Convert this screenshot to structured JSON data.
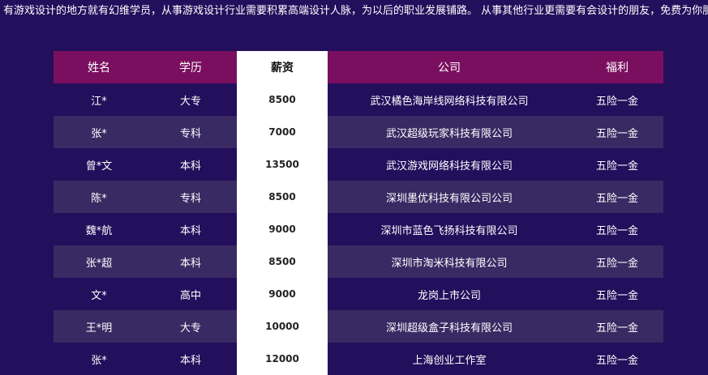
{
  "intro_text": "有游戏设计的地方就有幻维学员，从事游戏设计行业需要积累高端设计人脉，为以后的职业发展铺路。 从事其他行业更需要有会设计的朋友，免费为你服务。",
  "table": {
    "headers": {
      "name": "姓名",
      "education": "学历",
      "salary": "薪资",
      "company": "公司",
      "benefits": "福利"
    },
    "rows": [
      {
        "name": "江*",
        "education": "大专",
        "salary": "8500",
        "company": "武汉橘色海岸线网络科技有限公司",
        "benefits": "五险一金"
      },
      {
        "name": "张*",
        "education": "专科",
        "salary": "7000",
        "company": "武汉超级玩家科技有限公司",
        "benefits": "五险一金"
      },
      {
        "name": "曾*文",
        "education": "本科",
        "salary": "13500",
        "company": "武汉游戏网络科技有限公司",
        "benefits": "五险一金"
      },
      {
        "name": "陈*",
        "education": "专科",
        "salary": "8500",
        "company": "深圳墨优科技有限公司公司",
        "benefits": "五险一金"
      },
      {
        "name": "魏*航",
        "education": "本科",
        "salary": "9000",
        "company": "深圳市蓝色飞扬科技有限公司",
        "benefits": "五险一金"
      },
      {
        "name": "张*超",
        "education": "本科",
        "salary": "8500",
        "company": "深圳市淘米科技有限公司",
        "benefits": "五险一金"
      },
      {
        "name": "文*",
        "education": "高中",
        "salary": "9000",
        "company": "龙岗上市公司",
        "benefits": "五险一金"
      },
      {
        "name": "王*明",
        "education": "大专",
        "salary": "10000",
        "company": "深圳超级盒子科技有限公司",
        "benefits": "五险一金"
      },
      {
        "name": "张*",
        "education": "本科",
        "salary": "12000",
        "company": "上海创业工作室",
        "benefits": "五险一金"
      }
    ]
  }
}
